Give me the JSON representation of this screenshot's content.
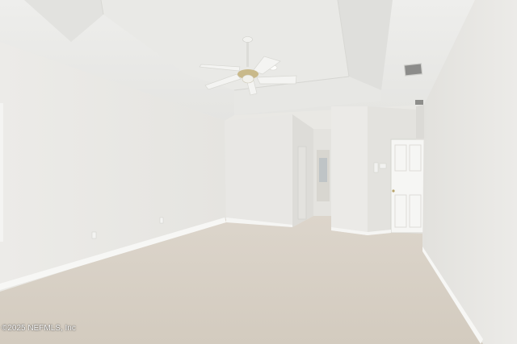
{
  "watermark": {
    "text": "©2025 NEFMLS, Inc"
  }
}
